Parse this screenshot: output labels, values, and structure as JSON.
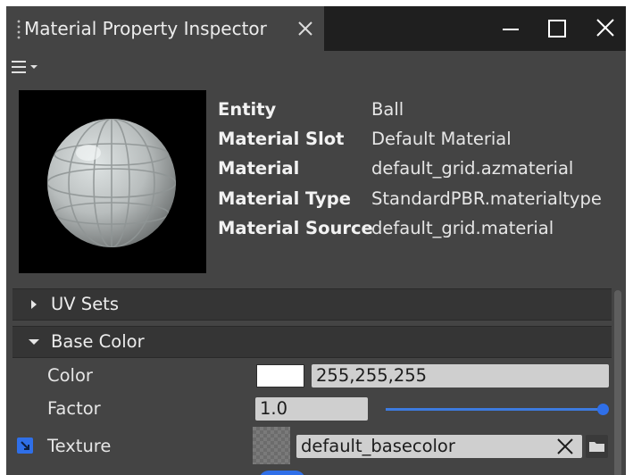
{
  "window": {
    "tab_title": "Material Property Inspector",
    "icons": {
      "tab_close": "close-icon",
      "minimize": "minimize-icon",
      "maximize": "maximize-icon",
      "close": "close-icon",
      "menu": "hamburger-menu-icon"
    }
  },
  "info": {
    "rows": [
      {
        "key": "Entity",
        "value": "Ball"
      },
      {
        "key": "Material Slot",
        "value": "Default Material"
      },
      {
        "key": "Material",
        "value": "default_grid.azmaterial"
      },
      {
        "key": "Material Type",
        "value": "StandardPBR.materialtype"
      },
      {
        "key": "Material Source",
        "value": "default_grid.material"
      }
    ]
  },
  "sections": {
    "uv_sets": {
      "label": "UV Sets",
      "expanded": false
    },
    "base_color": {
      "label": "Base Color",
      "expanded": true
    }
  },
  "base_color": {
    "color_label": "Color",
    "color_value": "255,255,255",
    "color_swatch": "#ffffff",
    "factor_label": "Factor",
    "factor_value": "1.0",
    "factor_slider_fraction": 1.0,
    "texture_label": "Texture",
    "texture_value": "default_basecolor"
  },
  "colors": {
    "accent": "#2f6fe8",
    "panel": "#444444",
    "titlebar": "#1f1f1f"
  }
}
